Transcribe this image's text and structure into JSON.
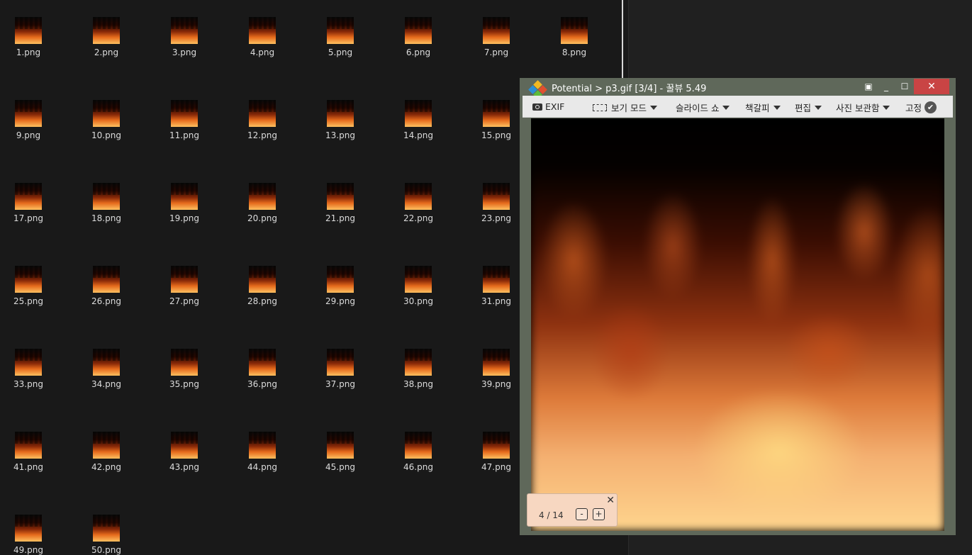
{
  "explorer": {
    "files": [
      "1.png",
      "2.png",
      "3.png",
      "4.png",
      "5.png",
      "6.png",
      "7.png",
      "8.png",
      "9.png",
      "10.png",
      "11.png",
      "12.png",
      "13.png",
      "14.png",
      "15.png",
      "17.png",
      "18.png",
      "19.png",
      "20.png",
      "21.png",
      "22.png",
      "23.png",
      "25.png",
      "26.png",
      "27.png",
      "28.png",
      "29.png",
      "30.png",
      "31.png",
      "33.png",
      "34.png",
      "35.png",
      "36.png",
      "37.png",
      "38.png",
      "39.png",
      "41.png",
      "42.png",
      "43.png",
      "44.png",
      "45.png",
      "46.png",
      "47.png",
      "49.png",
      "50.png"
    ]
  },
  "viewer": {
    "title": "Potential  >  p3.gif [3/4]  -  꿀뷰 5.49",
    "window_buttons": {
      "fit": "▣",
      "minimize": "_",
      "maximize": "☐",
      "close": "✕"
    },
    "toolbar": {
      "exif": "EXIF",
      "view_mode": "보기 모드",
      "slideshow": "슬라이드 쇼",
      "bookmark": "책갈피",
      "edit": "편집",
      "photo_storage": "사진 보관함",
      "pin": "고정",
      "pin_check": "✔"
    },
    "page_nav": {
      "close": "✕",
      "current": "4",
      "separator": "/",
      "total": "14",
      "text": "4 / 14",
      "minus": "-",
      "plus": "+"
    }
  },
  "colors": {
    "background": "#191919",
    "viewer_frame": "#5f685a",
    "close_button": "#c94444",
    "toolbar_bg": "#e9e9e9",
    "page_nav_bg": "#f7d7c1"
  }
}
